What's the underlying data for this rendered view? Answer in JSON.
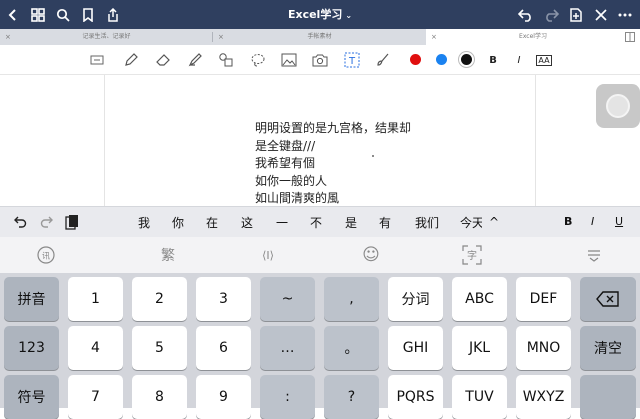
{
  "header": {
    "title": "Excel学习",
    "title_caret": "⌄"
  },
  "tabs": [
    {
      "label": "记录生活、记录好",
      "active": false
    },
    {
      "label": "手帐素材",
      "active": false
    },
    {
      "label": "Excel学习",
      "active": true
    }
  ],
  "tab_close": "×",
  "toolbar": {
    "text_tool": "T",
    "colors": [
      "#e00e0e",
      "#1a82f0",
      "#111111"
    ],
    "bold": "B",
    "italic": "I",
    "font_size": "AA"
  },
  "note_lines": [
    "明明设置的是九宫格，结果却",
    "是全键盘///",
    "我希望有個",
    "如你一般的人",
    "如山間清爽的風"
  ],
  "candidates": [
    "我",
    "你",
    "在",
    "这",
    "一",
    "不",
    "是",
    "有",
    "我们",
    "今天"
  ],
  "format": {
    "bold": "B",
    "italic": "I",
    "underline": "U",
    "collapse": "^"
  },
  "function_row": {
    "traditional": "繁",
    "cursor": "⟨I⟩",
    "emoji": "☺",
    "scan": "字",
    "hide": "⩡"
  },
  "keys": {
    "row1": [
      "拼音",
      "1",
      "2",
      "3",
      "~",
      ",",
      "分词",
      "ABC",
      "DEF",
      "⌫"
    ],
    "row2": [
      "123",
      "4",
      "5",
      "6",
      "…",
      "。",
      "GHI",
      "JKL",
      "MNO",
      "清空"
    ],
    "row3": [
      "符号",
      "7",
      "8",
      "9",
      ":",
      "?",
      "PQRS",
      "TUV",
      "WXYZ",
      ""
    ]
  }
}
